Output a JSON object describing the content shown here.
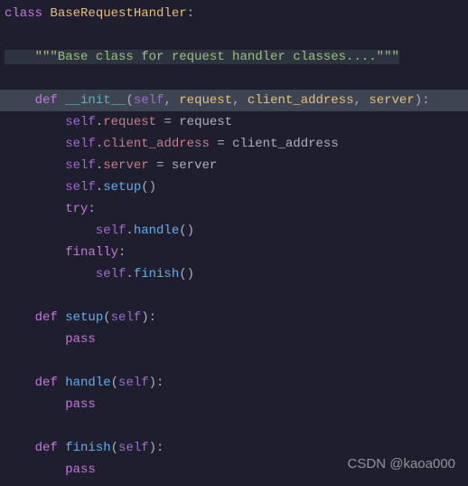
{
  "code": {
    "l1_kw_class": "class",
    "l1_cls": " BaseRequestHandler",
    "l1_colon": ":",
    "l3_doc": "    \"\"\"Base class for request handler classes....\"\"\"",
    "l5_def": "    def ",
    "l5_fn": "__init__",
    "l5_open": "(",
    "l5_self": "self",
    "l5_c1": ", ",
    "l5_p1": "request",
    "l5_c2": ", ",
    "l5_p2": "client_address",
    "l5_c3": ", ",
    "l5_p3": "server",
    "l5_close": "):",
    "l6_self": "        self",
    "l6_dot": ".",
    "l6_attr": "request",
    "l6_op": " = ",
    "l6_val": "request",
    "l7_self": "        self",
    "l7_dot": ".",
    "l7_attr": "client_address",
    "l7_op": " = ",
    "l7_val": "client_address",
    "l8_self": "        self",
    "l8_dot": ".",
    "l8_attr": "server",
    "l8_op": " = ",
    "l8_val": "server",
    "l9_self": "        self",
    "l9_dot": ".",
    "l9_call": "setup",
    "l9_paren": "()",
    "l10_try": "        try",
    "l10_colon": ":",
    "l11_self": "            self",
    "l11_dot": ".",
    "l11_call": "handle",
    "l11_paren": "()",
    "l12_fin": "        finally",
    "l12_colon": ":",
    "l13_self": "            self",
    "l13_dot": ".",
    "l13_call": "finish",
    "l13_paren": "()",
    "l15_def": "    def ",
    "l15_fn": "setup",
    "l15_open": "(",
    "l15_self": "self",
    "l15_close": "):",
    "l16_pass": "        pass",
    "l18_def": "    def ",
    "l18_fn": "handle",
    "l18_open": "(",
    "l18_self": "self",
    "l18_close": "):",
    "l19_pass": "        pass",
    "l21_def": "    def ",
    "l21_fn": "finish",
    "l21_open": "(",
    "l21_self": "self",
    "l21_close": "):",
    "l22_pass": "        pass"
  },
  "watermark": "CSDN @kaoa000"
}
